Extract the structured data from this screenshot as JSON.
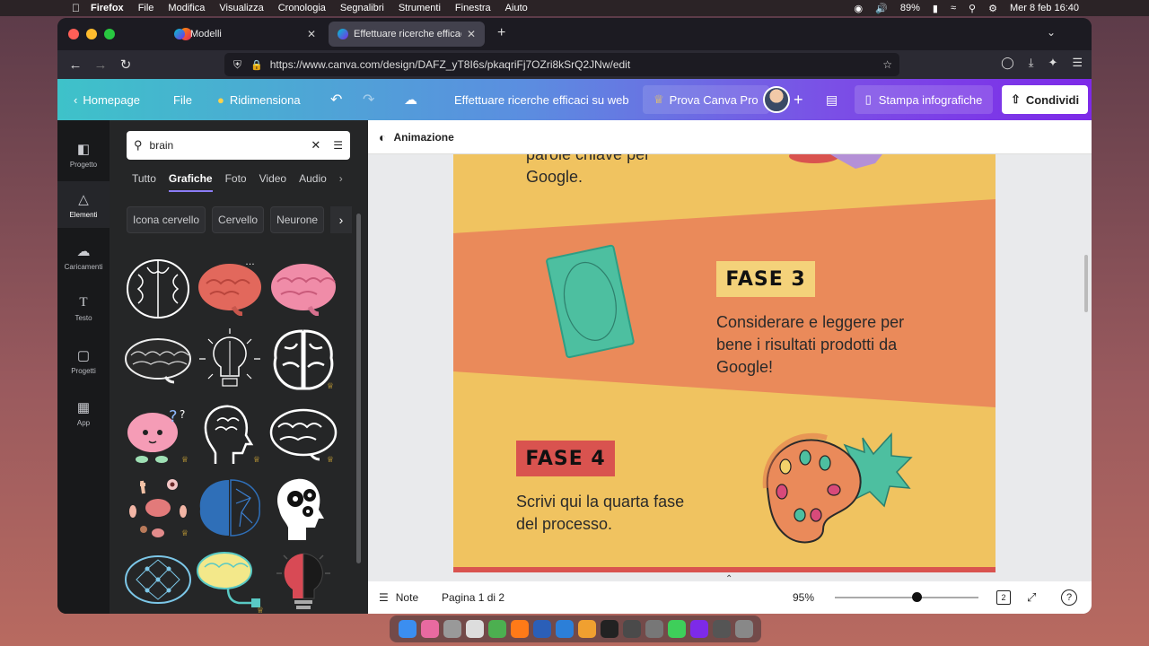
{
  "menubar": {
    "app": "Firefox",
    "items": [
      "File",
      "Modifica",
      "Visualizza",
      "Cronologia",
      "Segnalibri",
      "Strumenti",
      "Finestra",
      "Aiuto"
    ],
    "battery": "89%",
    "datetime": "Mer 8 feb  16:40"
  },
  "browser": {
    "tabs": [
      {
        "label": "Modelli"
      },
      {
        "label": "Effettuare ricerche efficaci su web"
      }
    ],
    "url": "https://www.canva.com/design/DAFZ_yT8I6s/pkaqriFj7OZri8kSrQ2JNw/edit"
  },
  "canva_header": {
    "home": "Homepage",
    "file": "File",
    "resize": "Ridimensiona",
    "doc_title": "Effettuare ricerche efficaci su web",
    "pro": "Prova Canva Pro",
    "print": "Stampa infografiche",
    "share": "Condividi"
  },
  "rail": {
    "items": [
      {
        "label": "Progetto",
        "icon": "layout-icon"
      },
      {
        "label": "Elementi",
        "icon": "shapes-icon"
      },
      {
        "label": "Caricamenti",
        "icon": "cloud-upload-icon"
      },
      {
        "label": "Testo",
        "icon": "text-icon"
      },
      {
        "label": "Progetti",
        "icon": "folder-icon"
      },
      {
        "label": "App",
        "icon": "apps-grid-icon"
      }
    ]
  },
  "panel": {
    "search_value": "brain",
    "tabs": [
      "Tutto",
      "Grafiche",
      "Foto",
      "Video",
      "Audio"
    ],
    "selected_tab": "Grafiche",
    "chips": [
      "Icona cervello",
      "Cervello",
      "Neurone"
    ]
  },
  "editor": {
    "animation": "Animazione",
    "canvas": {
      "top_text": "parole chiave per\nGoogle.",
      "fase3_label": "FASE 3",
      "fase3_text": "Considerare e leggere per\nbene i risultati prodotti da\nGoogle!",
      "fase4_label": "FASE 4",
      "fase4_text": "Scrivi qui la quarta fase\ndel processo."
    },
    "footer": {
      "notes": "Note",
      "page": "Pagina 1 di 2",
      "zoom": "95%",
      "page_count": "2",
      "help": "?"
    }
  },
  "colors": {
    "canvas_yellow": "#f0c360",
    "canvas_orange": "#ea8a5a",
    "fase3_bg": "#f4d27a",
    "fase4_bg": "#d9534f",
    "ticket": "#4dbfa0",
    "accent": "#7d2ae8"
  }
}
